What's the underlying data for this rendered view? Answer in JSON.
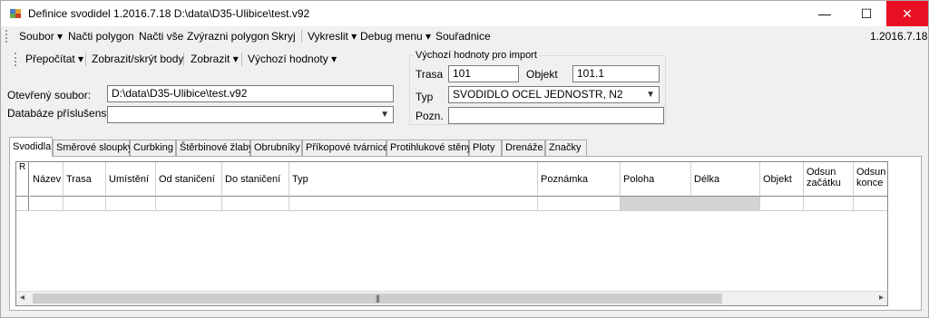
{
  "window": {
    "title": "Definice svodidel 1.2016.7.18 D:\\data\\D35-Ulibice\\test.v92",
    "min_glyph": "—",
    "max_glyph": "☐",
    "close_glyph": "✕"
  },
  "menu": {
    "items": [
      {
        "label": "Soubor",
        "dropdown": true
      },
      {
        "label": "Načti polygon",
        "dropdown": false
      },
      {
        "label": "Načti vše",
        "dropdown": false
      },
      {
        "label": "Zvýrazni polygon",
        "dropdown": false
      },
      {
        "label": "Skryj",
        "dropdown": false
      },
      {
        "label": "Vykreslit",
        "dropdown": true
      },
      {
        "label": "Debug menu",
        "dropdown": true
      },
      {
        "label": "Souřadnice",
        "dropdown": false
      }
    ],
    "version": "1.2016.7.18"
  },
  "toolbar": {
    "items": [
      {
        "label": "Přepočítat",
        "dropdown": true
      },
      {
        "label": "Zobrazit/skrýt body",
        "dropdown": false
      },
      {
        "label": "Zobrazit",
        "dropdown": true
      },
      {
        "label": "Výchozí hodnoty",
        "dropdown": true
      }
    ]
  },
  "form": {
    "open_file_label": "Otevřený soubor:",
    "open_file_value": "D:\\data\\D35-Ulibice\\test.v92",
    "accessories_db_label": "Databáze příslušenství",
    "accessories_db_value": ""
  },
  "defaults_group": {
    "title": "Výchozí hodnoty pro import",
    "trasa_label": "Trasa",
    "trasa_value": "101",
    "objekt_label": "Objekt",
    "objekt_value": "101.1",
    "typ_label": "Typ",
    "typ_value": "SVODIDLO OCEL JEDNOSTR, N2",
    "pozn_label": "Pozn.",
    "pozn_value": ""
  },
  "tabs": [
    {
      "label": "Svodidla",
      "active": true
    },
    {
      "label": "Směrové sloupky",
      "active": false
    },
    {
      "label": "Curbking",
      "active": false
    },
    {
      "label": "Štěrbinové žlaby",
      "active": false
    },
    {
      "label": "Obrubníky",
      "active": false
    },
    {
      "label": "Příkopové tvárnice",
      "active": false
    },
    {
      "label": "Protihlukové stěny",
      "active": false
    },
    {
      "label": "Ploty",
      "active": false
    },
    {
      "label": "Drenáže",
      "active": false
    },
    {
      "label": "Značky",
      "active": false
    }
  ],
  "grid": {
    "row_header_label": "R",
    "columns": [
      "Název",
      "Trasa",
      "Umístění",
      "Od staničení",
      "Do staničení",
      "Typ",
      "Poznámka",
      "Poloha",
      "Délka",
      "Objekt",
      "Odsun začátku",
      "Odsun konce"
    ]
  },
  "scrollbar": {
    "left_glyph": "◂",
    "right_glyph": "▸",
    "grip_glyph": "|||"
  },
  "colors": {
    "close_button": "#e81123",
    "readonly_cell": "#d3d3d3"
  }
}
